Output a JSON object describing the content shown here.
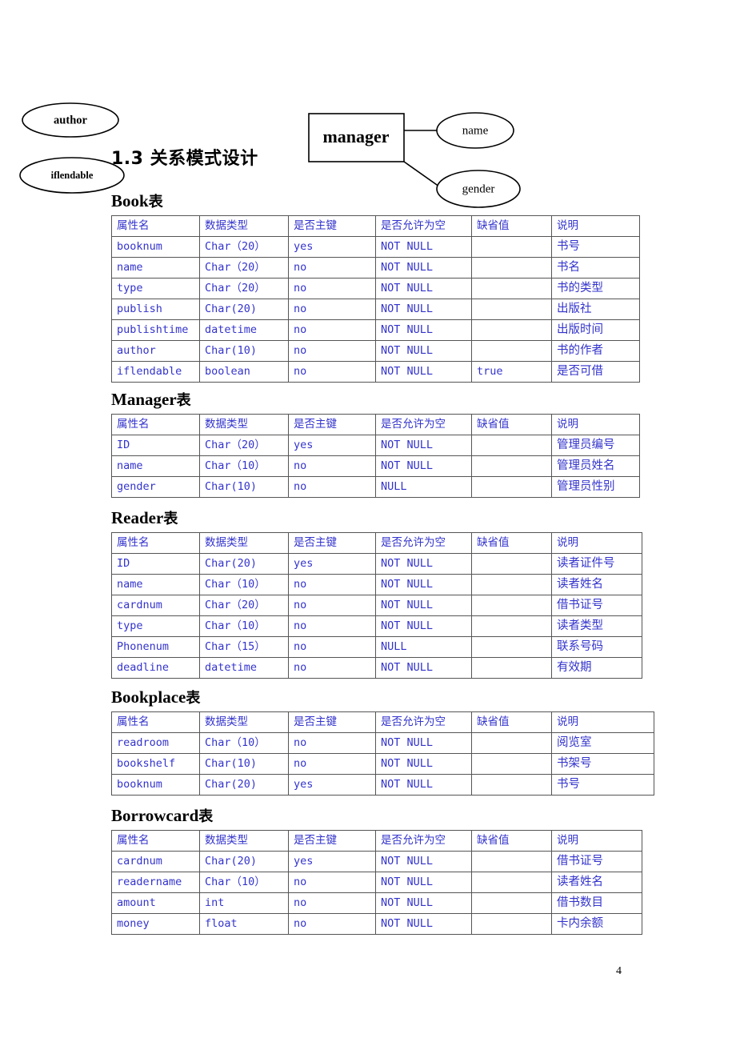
{
  "page": {
    "number": "4"
  },
  "er_diagram": {
    "entity": {
      "label": "manager"
    },
    "attributes": [
      {
        "label": "author"
      },
      {
        "label": "iflendable"
      },
      {
        "label": "name"
      },
      {
        "label": "gender"
      }
    ]
  },
  "section": {
    "heading": "1.3  关系模式设计"
  },
  "columns": [
    "属性名",
    "数据类型",
    "是否主键",
    "是否允许为空",
    "缺省值",
    "说明"
  ],
  "tables": [
    {
      "title_en": "Book",
      "title_cjk": "表",
      "rows": [
        [
          "booknum",
          "Char（20）",
          "yes",
          "NOT NULL",
          "",
          "书号"
        ],
        [
          "name",
          "Char（20）",
          "no",
          "NOT NULL",
          "",
          "书名"
        ],
        [
          "type",
          "Char（20）",
          "no",
          "NOT NULL",
          "",
          "书的类型"
        ],
        [
          "publish",
          "Char(20)",
          "no",
          "NOT NULL",
          "",
          "出版社"
        ],
        [
          "publishtime",
          "datetime",
          "no",
          "NOT NULL",
          "",
          "出版时间"
        ],
        [
          "author",
          "Char(10)",
          "no",
          "NOT NULL",
          "",
          "书的作者"
        ],
        [
          "iflendable",
          "boolean",
          "no",
          "NOT NULL",
          "true",
          "是否可借"
        ]
      ]
    },
    {
      "title_en": "Manager",
      "title_cjk": "表",
      "rows": [
        [
          "ID",
          "Char（20）",
          "yes",
          "NOT NULL",
          "",
          "管理员编号"
        ],
        [
          "name",
          "Char（10）",
          "no",
          "NOT NULL",
          "",
          "管理员姓名"
        ],
        [
          "gender",
          "Char(10)",
          "no",
          "NULL",
          "",
          "管理员性别"
        ]
      ]
    },
    {
      "title_en": "Reader",
      "title_cjk": "表",
      "rows": [
        [
          "ID",
          "Char(20)",
          "yes",
          "NOT NULL",
          "",
          "读者证件号"
        ],
        [
          "name",
          "Char（10）",
          "no",
          "NOT NULL",
          "",
          "读者姓名"
        ],
        [
          "cardnum",
          "Char（20）",
          "no",
          "NOT NULL",
          "",
          "借书证号"
        ],
        [
          "type",
          "Char（10）",
          "no",
          "NOT NULL",
          "",
          "读者类型"
        ],
        [
          "Phonenum",
          "Char（15）",
          "no",
          "NULL",
          "",
          "联系号码"
        ],
        [
          "deadline",
          "datetime",
          "no",
          "NOT NULL",
          "",
          "有效期"
        ]
      ]
    },
    {
      "title_en": "Bookplace",
      "title_cjk": "表",
      "rows": [
        [
          "readroom",
          "Char（10）",
          "no",
          "NOT NULL",
          "",
          "阅览室"
        ],
        [
          "bookshelf",
          "Char(10)",
          "no",
          "NOT NULL",
          "",
          "书架号"
        ],
        [
          "booknum",
          "Char(20)",
          "yes",
          "NOT NULL",
          "",
          "书号"
        ]
      ]
    },
    {
      "title_en": "Borrowcard",
      "title_cjk": "表",
      "rows": [
        [
          "cardnum",
          "Char(20)",
          "yes",
          "NOT NULL",
          "",
          "借书证号"
        ],
        [
          "readername",
          "Char（10）",
          "no",
          "NOT NULL",
          "",
          "读者姓名"
        ],
        [
          "amount",
          "int",
          "no",
          "NOT NULL",
          "",
          "借书数目"
        ],
        [
          "money",
          "float",
          "no",
          "NOT NULL",
          "",
          "卡内余额"
        ]
      ]
    }
  ],
  "colors": {
    "table_text": "#3333cc",
    "border": "#555555",
    "ink": "#000000"
  }
}
